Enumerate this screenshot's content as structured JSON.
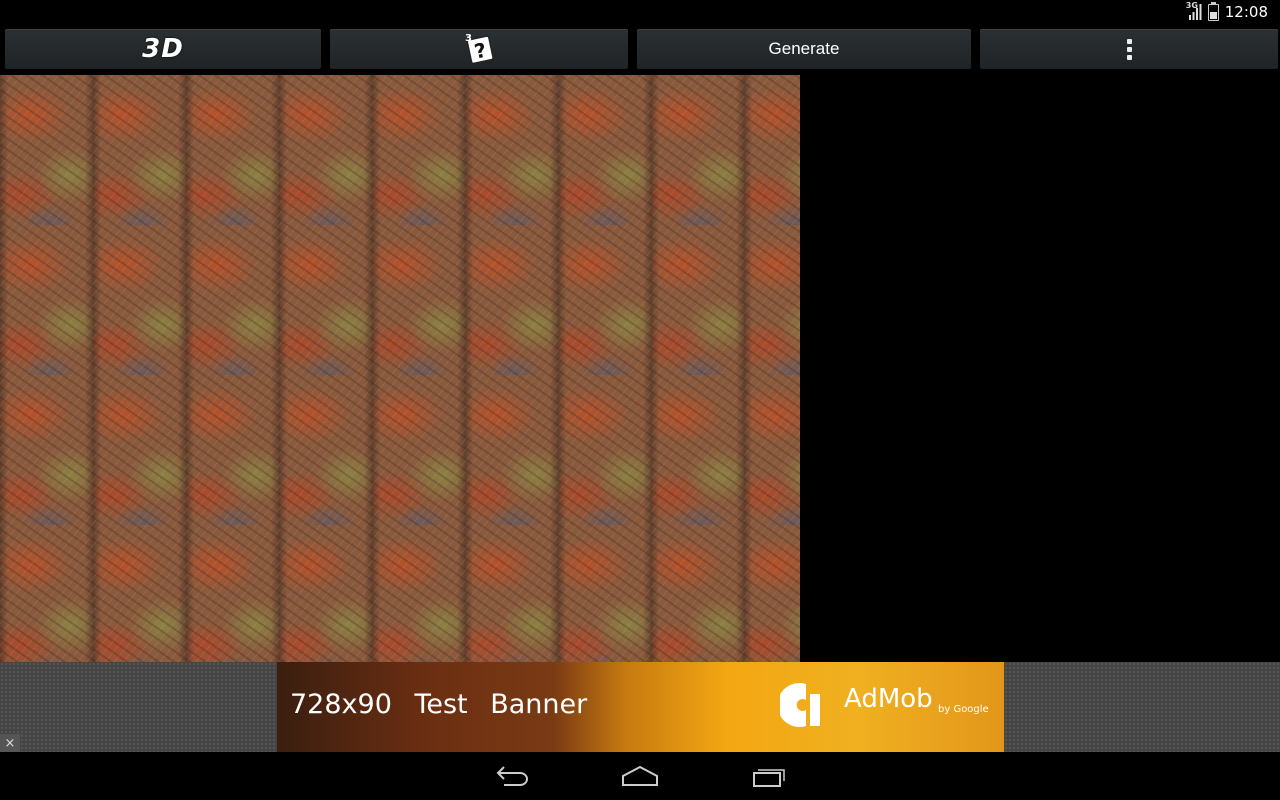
{
  "status_bar": {
    "network": "3G",
    "time": "12:08",
    "battery_level": 0.5
  },
  "toolbar": {
    "btn_3d_label": "3D",
    "help_icon_superscript": "3",
    "help_icon_glyph": "?",
    "generate_label": "Generate",
    "more_icon": "overflow-menu-icon"
  },
  "ad": {
    "size_label": "728x90",
    "title": "Test Banner",
    "brand": "AdMob",
    "brand_by": "by Google",
    "close_glyph": "×"
  },
  "nav": {
    "back": "back-icon",
    "home": "home-icon",
    "recents": "recents-icon"
  }
}
